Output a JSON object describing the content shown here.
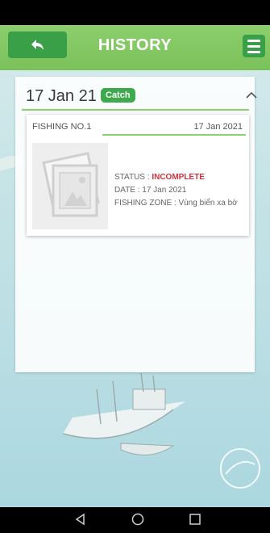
{
  "header": {
    "title": "HISTORY",
    "back_icon": "reply-arrow-icon",
    "menu_icon": "hamburger-menu-icon"
  },
  "group": {
    "date": "17 Jan 21",
    "badge": "Catch",
    "chevron_icon": "chevron-up-icon"
  },
  "record": {
    "name": "FISHING NO.1",
    "date": "17 Jan 2021",
    "thumbnail_icon": "photo-placeholder-icon",
    "status_label": "STATUS : ",
    "status_value": "INCOMPLETE",
    "date_line": "DATE : 17 Jan 2021",
    "zone_line": "FISHING ZONE : Vùng biển xa bờ"
  },
  "nav": {
    "back_icon": "triangle-back-icon",
    "home_icon": "circle-home-icon",
    "recents_icon": "square-recents-icon"
  },
  "colors": {
    "header_green": "#7bc15b",
    "button_green": "#3aa047",
    "badge_green": "#3eaa4d",
    "status_red": "#d0323e"
  }
}
